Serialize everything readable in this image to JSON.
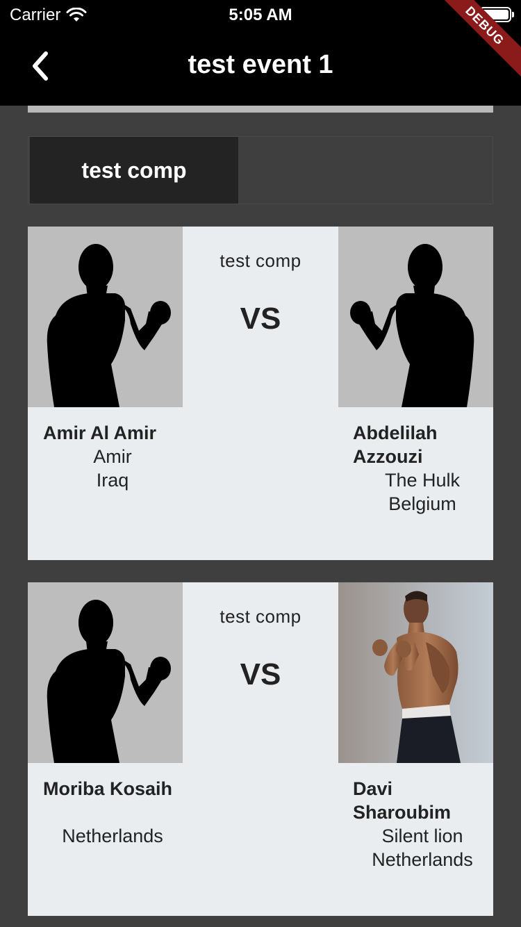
{
  "status_bar": {
    "carrier": "Carrier",
    "time": "5:05 AM"
  },
  "app_bar": {
    "title": "test event 1",
    "debug_label": "DEBUG"
  },
  "competition_tab": {
    "label": "test comp"
  },
  "matches": [
    {
      "comp_label": "test comp",
      "vs_label": "VS",
      "left": {
        "name": "Amir Al Amir",
        "nickname": "Amir",
        "country": "Iraq"
      },
      "right": {
        "name": "Abdelilah Azzouzi",
        "nickname": "The Hulk",
        "country": "Belgium"
      }
    },
    {
      "comp_label": "test comp",
      "vs_label": "VS",
      "left": {
        "name": "Moriba Kosaih",
        "nickname": "",
        "country": "Netherlands"
      },
      "right": {
        "name": "Davi Sharoubim",
        "nickname": "Silent lion",
        "country": "Netherlands"
      }
    }
  ]
}
